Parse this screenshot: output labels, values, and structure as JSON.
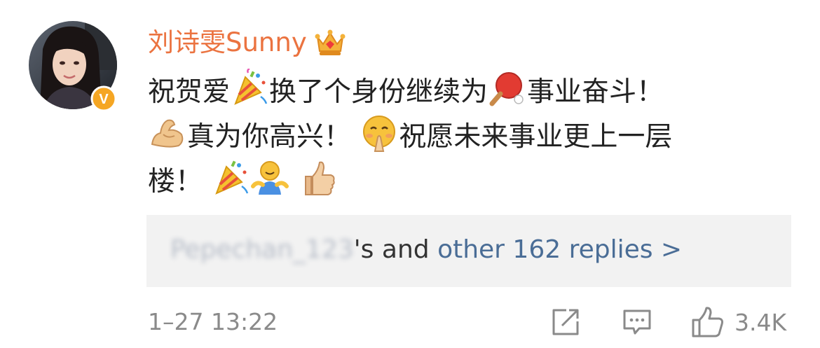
{
  "post": {
    "username": "刘诗雯Sunny",
    "verified_badge": "V",
    "comment_lines": [
      {
        "part1": "祝贺爱",
        "part2": "换了个身份继续为",
        "part3": "事业奋斗！"
      },
      {
        "part1": "真为你高兴！",
        "part2": "祝愿未来事业更上一层"
      },
      {
        "part1": "楼！"
      }
    ],
    "replies": {
      "blurred_user": "Pepechan_123",
      "suffix": "'s and ",
      "link": "other 162 replies >"
    },
    "timestamp": "1–27 13:22",
    "like_count": "3.4K"
  },
  "icons": {
    "crown": "vip-crown-icon",
    "party": "party-popper-icon",
    "pingpong": "ping-pong-icon",
    "muscle": "flexed-biceps-icon",
    "hands": "praying-face-icon",
    "hug": "hug-person-icon",
    "thumbs": "thumbs-up-emoji-icon",
    "repost": "repost-icon",
    "comment": "comment-icon",
    "like": "like-icon"
  },
  "colors": {
    "username": "#eb7340",
    "link": "#4a6d96",
    "meta": "#8a8a8a",
    "replies_bg": "#f2f2f2",
    "verified": "#f5a623"
  }
}
